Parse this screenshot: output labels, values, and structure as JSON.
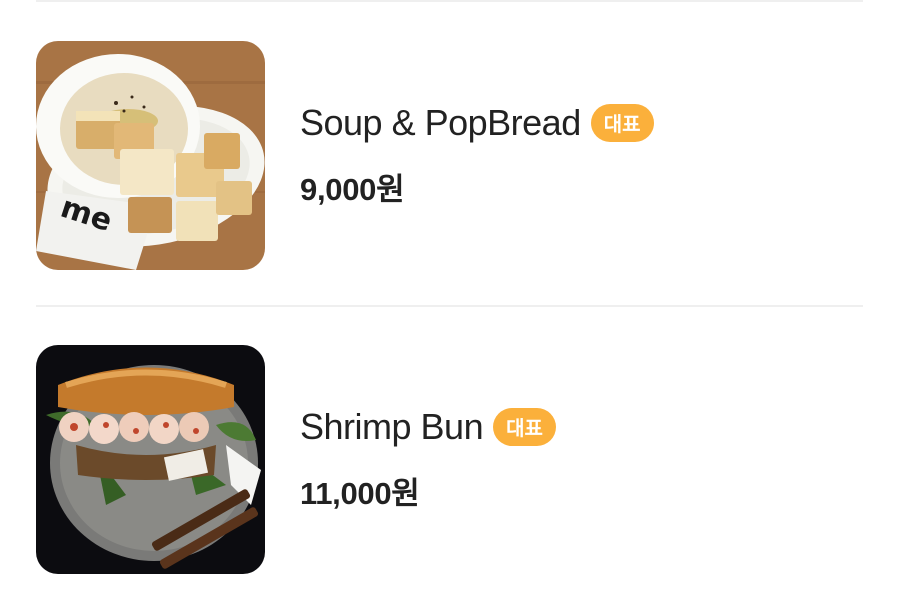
{
  "menu": {
    "items": [
      {
        "name": "Soup & PopBread",
        "badge": "대표",
        "price": "9,000원",
        "image_icon": "soup-photo"
      },
      {
        "name": "Shrimp Bun",
        "badge": "대표",
        "price": "11,000원",
        "image_icon": "shrimp-bun-photo"
      }
    ],
    "badge_color": "#fbb03b",
    "divider_color": "#efefef"
  }
}
